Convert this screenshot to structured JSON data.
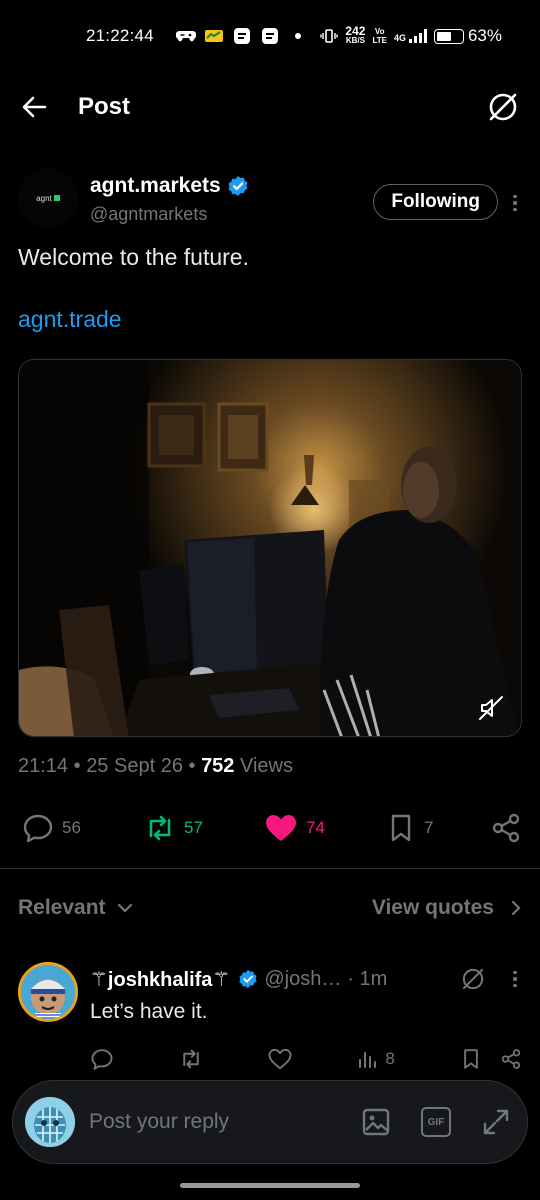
{
  "status_bar": {
    "time": "21:22:44",
    "net_speed_value": "242",
    "net_speed_unit": "KB/S",
    "signal_label": "4G",
    "battery": "63%",
    "battery_level": 0.63
  },
  "header": {
    "title": "Post"
  },
  "post": {
    "author_name": "agnt.markets",
    "author_handle": "@agntmarkets",
    "avatar_text": "agnt",
    "follow_label": "Following",
    "text": "Welcome to the future.",
    "link": "agnt.trade",
    "time": "21:14",
    "date": "25 Sept 26",
    "views_count": "752",
    "views_label": "Views",
    "replies": "56",
    "reposts": "57",
    "likes": "74",
    "bookmarks": "7"
  },
  "replies_section": {
    "sort_label": "Relevant",
    "quotes_label": "View quotes"
  },
  "reply": {
    "name": "⚚joshkhalifa⚚",
    "handle": "@josh…",
    "time": "· 1m",
    "text": "Let’s have it.",
    "views": "8"
  },
  "composer": {
    "placeholder": "Post your reply",
    "gif_label": "GIF"
  },
  "colors": {
    "background": "#000000",
    "accent": "#1d9bf0",
    "repost": "#00ba7c",
    "like": "#f91880",
    "muted": "#71767b"
  },
  "icons": [
    "back-arrow-icon",
    "grok-icon",
    "verified-badge-icon",
    "mute-icon",
    "reply-icon",
    "repost-icon",
    "heart-icon",
    "bookmark-icon",
    "share-icon",
    "chevron-down-icon",
    "chevron-right-icon",
    "views-icon",
    "image-icon",
    "gif-icon",
    "expand-icon"
  ]
}
